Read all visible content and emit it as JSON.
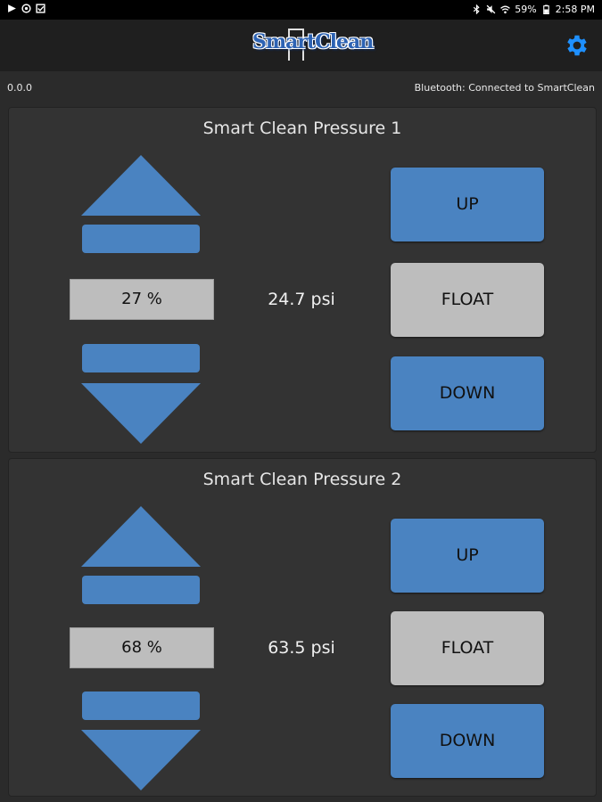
{
  "status_bar": {
    "battery": "59%",
    "time": "2:58 PM",
    "icons": [
      "play-icon",
      "crosshair-icon",
      "checkbox-icon",
      "bluetooth-icon",
      "mute-icon",
      "wifi-icon",
      "battery-icon"
    ]
  },
  "app_bar": {
    "logo_text": "SmartClean",
    "settings_icon": "gear-icon",
    "accent_color": "#1e90ff"
  },
  "info_bar": {
    "version": "0.0.0",
    "bluetooth_status": "Bluetooth: Connected to SmartClean"
  },
  "panels": [
    {
      "title": "Smart Clean Pressure 1",
      "percent": "27 %",
      "psi": "24.7 psi",
      "up_label": "UP",
      "float_label": "FLOAT",
      "down_label": "DOWN"
    },
    {
      "title": "Smart Clean Pressure 2",
      "percent": "68 %",
      "psi": "63.5 psi",
      "up_label": "UP",
      "float_label": "FLOAT",
      "down_label": "DOWN"
    }
  ],
  "colors": {
    "button_blue": "#4a83c1",
    "button_gray": "#bdbdbd",
    "background": "#2b2b2b"
  }
}
